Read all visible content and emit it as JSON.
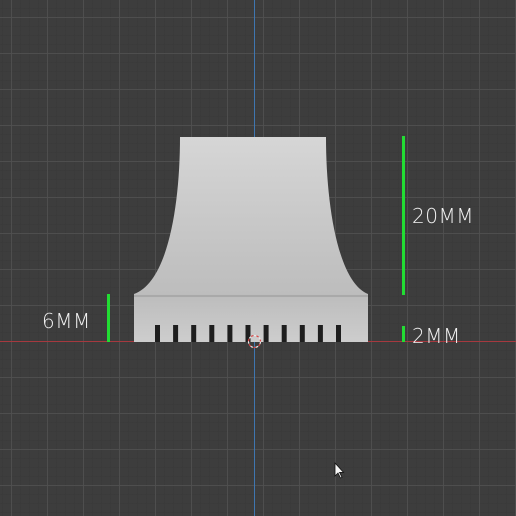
{
  "viewport": {
    "background_color": "#3d3d3d",
    "axis_x_color": "#a6393f",
    "axis_y_color": "#3f76b0",
    "dimension_line_color": "#22dd33"
  },
  "model": {
    "fill_color": "#cfcfcf",
    "slot_color": "#1e1e1e",
    "slot_count": 11
  },
  "dimensions": {
    "top_height": "20MM",
    "base_height": "6MM",
    "tooth_height": "2MM"
  },
  "icons": {
    "origin": "origin-marker-icon",
    "cursor": "mouse-cursor-icon"
  }
}
